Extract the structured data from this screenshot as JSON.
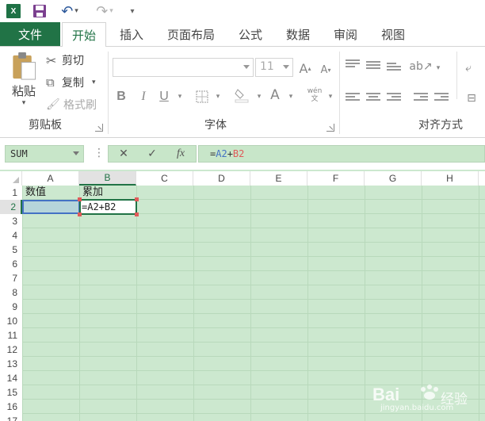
{
  "qat": {
    "logo": "X"
  },
  "tabs": [
    {
      "label": "文件"
    },
    {
      "label": "开始"
    },
    {
      "label": "插入"
    },
    {
      "label": "页面布局"
    },
    {
      "label": "公式"
    },
    {
      "label": "数据"
    },
    {
      "label": "审阅"
    },
    {
      "label": "视图"
    }
  ],
  "ribbon": {
    "clipboard": {
      "paste_label": "粘贴",
      "cut_label": "剪切",
      "copy_label": "复制",
      "format_painter_label": "格式刷",
      "group_label": "剪贴板"
    },
    "font": {
      "size_value": "11",
      "bold": "B",
      "italic": "I",
      "underline": "U",
      "font_color_icon": "A",
      "phonetic_icon": "wén 文",
      "grow_icon": "A",
      "shrink_icon": "A",
      "group_label": "字体"
    },
    "alignment": {
      "group_label": "对齐方式"
    }
  },
  "formula_bar": {
    "name_box": "SUM",
    "dots": "⋮",
    "cancel_icon": "✕",
    "enter_icon": "✓",
    "fx_icon": "fx",
    "formula_prefix": "=",
    "formula_ref_a": "A2",
    "formula_op": "+",
    "formula_ref_b": "B2"
  },
  "sheet": {
    "columns": [
      "A",
      "B",
      "C",
      "D",
      "E",
      "F",
      "G",
      "H"
    ],
    "rows": [
      "1",
      "2",
      "3",
      "4",
      "5",
      "6",
      "7",
      "8",
      "9",
      "10",
      "11",
      "12",
      "13",
      "14",
      "15",
      "16",
      "17"
    ],
    "cells": {
      "A1": "数值",
      "B1": "累加",
      "B2": "=A2+B2"
    }
  },
  "watermark": {
    "brand": "Bai",
    "brand_tail": "经验",
    "url": "jingyan.baidu.com"
  },
  "colors": {
    "accent": "#217346",
    "sheet_bg": "#cce8cf",
    "ref_a": "#4472c4",
    "ref_b": "#e05a5a"
  }
}
